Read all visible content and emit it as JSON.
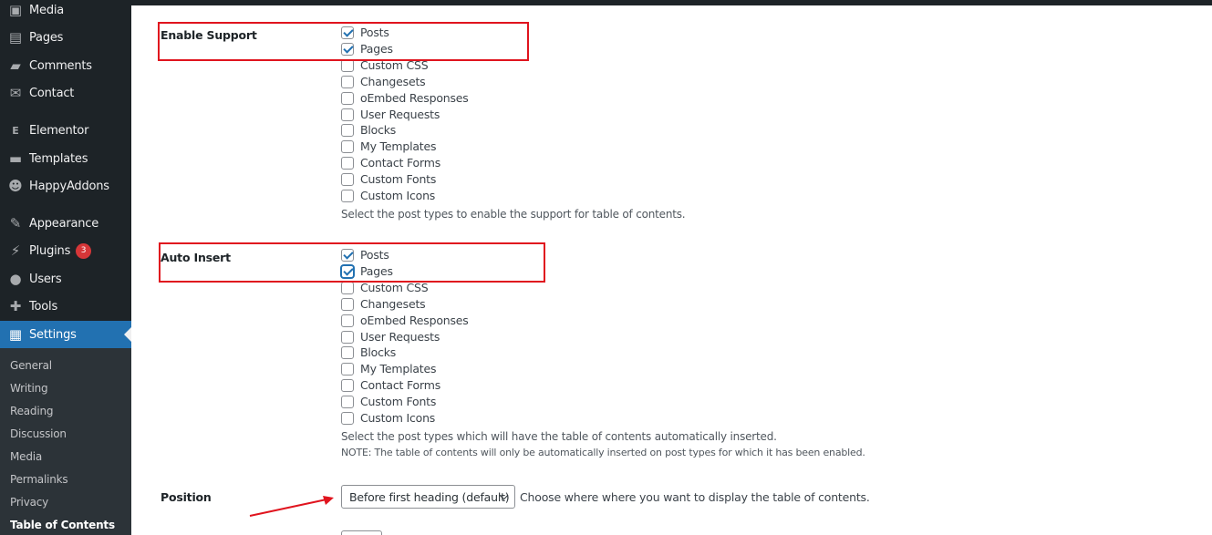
{
  "sidebar": {
    "items": [
      {
        "label": "Media",
        "icon": "media-icon",
        "glyph": "▣"
      },
      {
        "label": "Pages",
        "icon": "pages-icon",
        "glyph": "▤"
      },
      {
        "label": "Comments",
        "icon": "comments-icon",
        "glyph": "▰"
      },
      {
        "label": "Contact",
        "icon": "envelope-icon",
        "glyph": "✉"
      },
      {
        "label": "Elementor",
        "icon": "elementor-icon",
        "glyph": "E"
      },
      {
        "label": "Templates",
        "icon": "folder-icon",
        "glyph": "▬"
      },
      {
        "label": "HappyAddons",
        "icon": "happyaddons-icon",
        "glyph": "☻"
      },
      {
        "label": "Appearance",
        "icon": "brush-icon",
        "glyph": "✎"
      },
      {
        "label": "Plugins",
        "icon": "plugin-icon",
        "glyph": "⚡",
        "badge": "3"
      },
      {
        "label": "Users",
        "icon": "user-icon",
        "glyph": "●"
      },
      {
        "label": "Tools",
        "icon": "wrench-icon",
        "glyph": "✚"
      },
      {
        "label": "Settings",
        "icon": "settings-icon",
        "glyph": "▦"
      }
    ],
    "submenu": [
      "General",
      "Writing",
      "Reading",
      "Discussion",
      "Media",
      "Permalinks",
      "Privacy",
      "Table of Contents"
    ]
  },
  "enable_support": {
    "label": "Enable Support",
    "options": [
      {
        "label": "Posts",
        "checked": true
      },
      {
        "label": "Pages",
        "checked": true
      },
      {
        "label": "Custom CSS",
        "checked": false
      },
      {
        "label": "Changesets",
        "checked": false
      },
      {
        "label": "oEmbed Responses",
        "checked": false
      },
      {
        "label": "User Requests",
        "checked": false
      },
      {
        "label": "Blocks",
        "checked": false
      },
      {
        "label": "My Templates",
        "checked": false
      },
      {
        "label": "Contact Forms",
        "checked": false
      },
      {
        "label": "Custom Fonts",
        "checked": false
      },
      {
        "label": "Custom Icons",
        "checked": false
      }
    ],
    "description": "Select the post types to enable the support for table of contents."
  },
  "auto_insert": {
    "label": "Auto Insert",
    "options": [
      {
        "label": "Posts",
        "checked": true
      },
      {
        "label": "Pages",
        "checked": true
      },
      {
        "label": "Custom CSS",
        "checked": false
      },
      {
        "label": "Changesets",
        "checked": false
      },
      {
        "label": "oEmbed Responses",
        "checked": false
      },
      {
        "label": "User Requests",
        "checked": false
      },
      {
        "label": "Blocks",
        "checked": false
      },
      {
        "label": "My Templates",
        "checked": false
      },
      {
        "label": "Contact Forms",
        "checked": false
      },
      {
        "label": "Custom Fonts",
        "checked": false
      },
      {
        "label": "Custom Icons",
        "checked": false
      }
    ],
    "description": "Select the post types which will have the table of contents automatically inserted.",
    "note": "NOTE: The table of contents will only be automatically inserted on post types for which it has been enabled."
  },
  "position": {
    "label": "Position",
    "selected": "Before first heading (default)",
    "description": "Choose where where you want to display the table of contents."
  },
  "colors": {
    "sidebar_bg": "#1d2327",
    "active": "#2271b1",
    "annotation": "#e0141e",
    "badge": "#d63638"
  }
}
